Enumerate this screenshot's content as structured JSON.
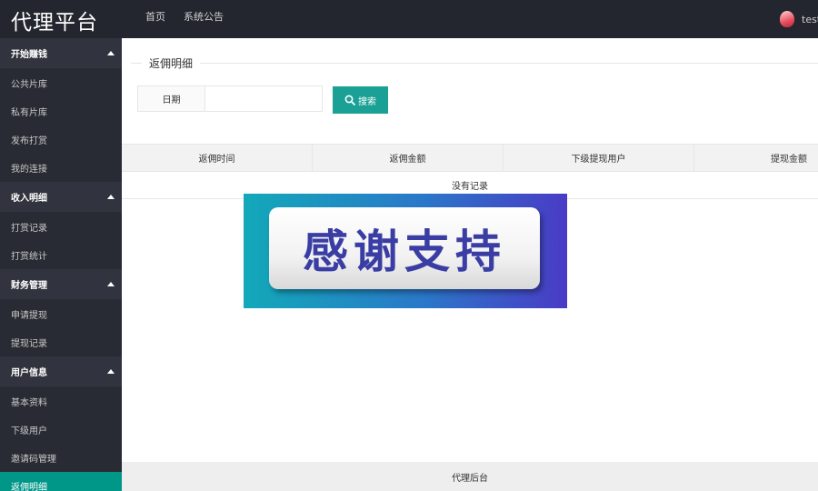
{
  "header": {
    "logo": "代理平台",
    "nav": [
      "首页",
      "系统公告"
    ],
    "username": "test"
  },
  "sidebar": {
    "groups": [
      {
        "title": "开始赚钱",
        "items": [
          "公共片库",
          "私有片库",
          "发布打赏",
          "我的连接"
        ]
      },
      {
        "title": "收入明细",
        "items": [
          "打赏记录",
          "打赏统计"
        ]
      },
      {
        "title": "财务管理",
        "items": [
          "申请提现",
          "提现记录"
        ]
      },
      {
        "title": "用户信息",
        "items": [
          "基本资料",
          "下级用户",
          "邀请码管理",
          "返佣明细"
        ]
      }
    ],
    "active_item": "返佣明细"
  },
  "main": {
    "legend": "返佣明细",
    "search": {
      "label": "日期",
      "value": "",
      "button": "搜索"
    },
    "table": {
      "columns": [
        "返佣时间",
        "返佣金额",
        "下级提现用户",
        "提现金额"
      ],
      "empty_text": "没有记录"
    },
    "footer": "代理后台"
  },
  "overlay": {
    "text": "感谢支持"
  },
  "colors": {
    "header_bg": "#23262e",
    "sidebar_bg": "#393d49",
    "accent": "#009688",
    "button": "#1aa094"
  }
}
